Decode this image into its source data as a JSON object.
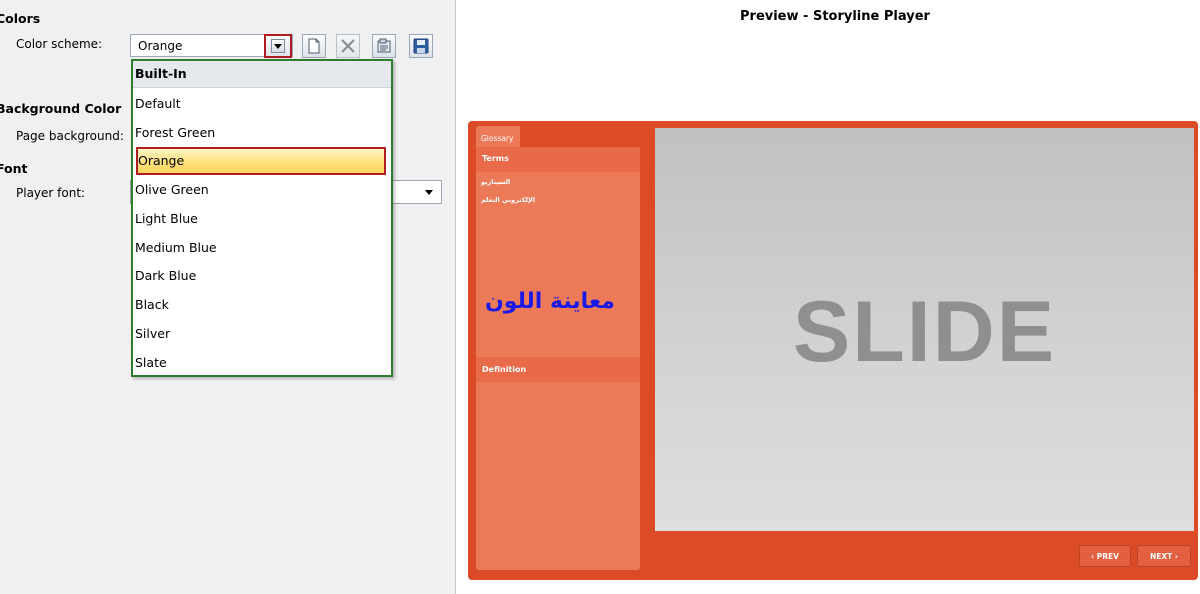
{
  "settings": {
    "colors_heading": "Colors",
    "color_scheme_label": "Color scheme:",
    "color_scheme_value": "Orange",
    "background_heading": "Background Color",
    "page_background_label": "Page background:",
    "font_heading": "Font",
    "player_font_label": "Player font:"
  },
  "dropdown": {
    "group_label": "Built-In",
    "options": [
      "Default",
      "Forest Green",
      "Orange",
      "Olive Green",
      "Light Blue",
      "Medium Blue",
      "Dark Blue",
      "Black",
      "Silver",
      "Slate"
    ],
    "selected": "Orange"
  },
  "toolbar": {
    "icons": [
      "new-document-icon",
      "delete-icon",
      "manage-icon",
      "save-icon"
    ]
  },
  "preview": {
    "title": "Preview - Storyline Player",
    "glossary_tab": "Glossary",
    "terms_header": "Terms",
    "terms": [
      "السيناريو",
      "الإلكتروني التعلم"
    ],
    "overlay_text": "معاينة اللون",
    "definition_header": "Definition",
    "slide_text": "SLIDE",
    "prev_label": "‹ PREV",
    "next_label": "NEXT ›"
  },
  "colors": {
    "player_accent": "#db4b27",
    "sidebar": "#ec7a59",
    "selection_border": "#b01c22",
    "dropdown_border": "#2d7d2d",
    "overlay_text": "#1a1ae8"
  }
}
